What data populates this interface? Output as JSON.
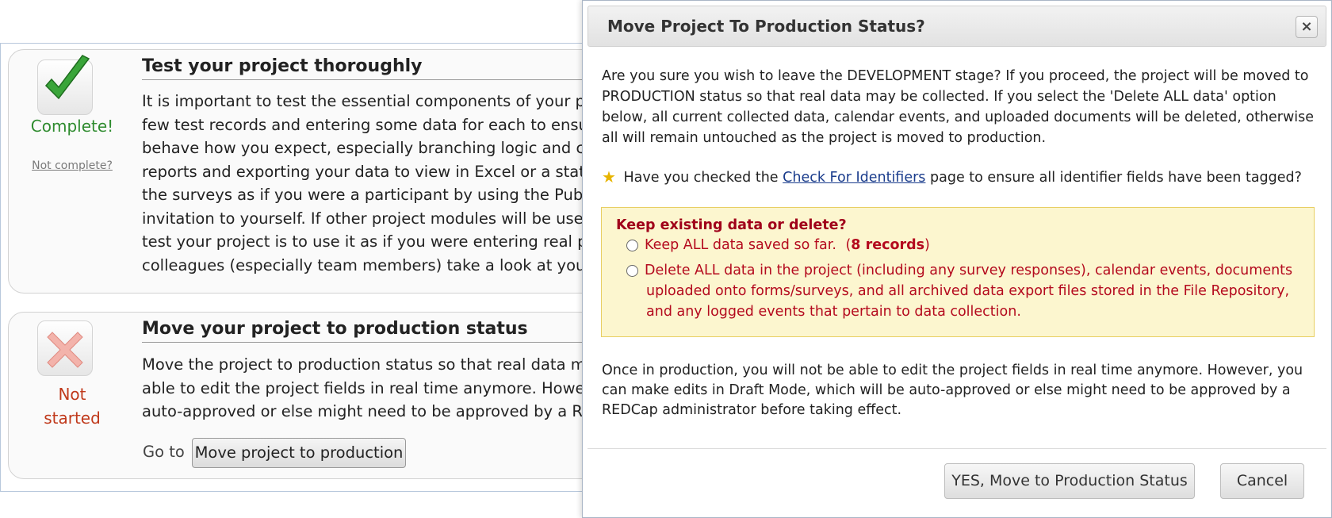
{
  "background": {
    "card1": {
      "title": "Test your project thoroughly",
      "status": "Complete!",
      "undo_link": "Not complete?",
      "lines": [
        "It is important to test the essential components of your proj",
        "few test records and entering some data for each to ensure",
        "behave how you expect, especially branching logic and calcu",
        "reports and exporting your data to view in Excel or a statistic",
        "the surveys as if you were a participant by using the Public S",
        "invitation to yourself. If other project modules will be used re",
        "test your project is to use it as if you were entering real prod",
        "colleagues (especially team members) take a look at your pr"
      ]
    },
    "card2": {
      "title": "Move your project to production status",
      "status_line1": "Not",
      "status_line2": "started",
      "lines": [
        "Move the project to production status so that real data may",
        "able to edit the project fields in real time anymore. However",
        "auto-approved or else might need to be approved by a REDC"
      ],
      "goto_label": "Go to",
      "goto_button": "Move project to production"
    }
  },
  "dialog": {
    "title": "Move Project To Production Status?",
    "close_symbol": "×",
    "intro_lines": [
      "Are you sure you wish to leave the DEVELOPMENT stage? If you proceed, the project will be moved to",
      "PRODUCTION status so that real data may be collected. If you select the 'Delete ALL data' option",
      "below, all current collected data, calendar events, and uploaded documents will be deleted, otherwise",
      "all will remain untouched as the project is moved to production."
    ],
    "identifiers": {
      "before": "Have you checked the",
      "link": "Check For Identifiers",
      "after": "page to ensure all identifier fields have been tagged?"
    },
    "options_box": {
      "title": "Keep existing data or delete?",
      "keep_label": "Keep ALL data saved so far.",
      "keep_count_open": "(",
      "keep_count": "8 records",
      "keep_count_close": ")",
      "delete_lines": [
        "Delete ALL data in the project (including any survey responses), calendar events, documents",
        "uploaded onto forms/surveys, and all archived data export files stored in the File Repository,",
        "and any logged events that pertain to data collection."
      ]
    },
    "footer_lines": [
      "Once in production, you will not be able to edit the project fields in real time anymore. However, you",
      "can make edits in Draft Mode, which will be auto-approved or else might need to be approved by a",
      "REDCap administrator before taking effect."
    ],
    "buttons": {
      "confirm": "YES, Move to Production Status",
      "cancel": "Cancel"
    }
  },
  "colors": {
    "complete": "#2e8b2e",
    "not_started": "#c0391b",
    "warning_text": "#b40a1e",
    "warning_bg": "#fcf6cf",
    "link": "#1a3c8c"
  },
  "icons": [
    "checkmark-icon",
    "x-mark-icon",
    "star-icon",
    "close-icon"
  ]
}
